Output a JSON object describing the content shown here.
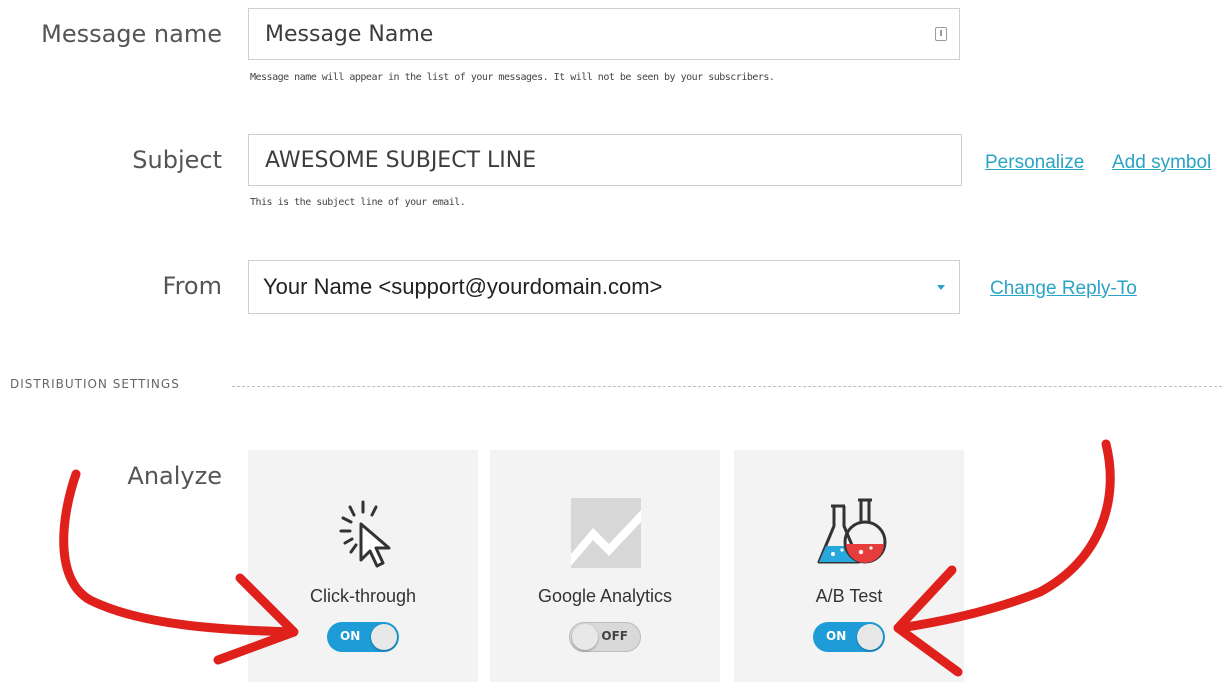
{
  "form": {
    "message_name": {
      "label": "Message name",
      "value": "Message Name",
      "help": "Message name will appear in the list of your messages. It will not be seen by your subscribers.",
      "icon": "character-count-icon"
    },
    "subject": {
      "label": "Subject",
      "value": "AWESOME SUBJECT LINE",
      "help": "This is the subject line of your email.",
      "links": [
        "Personalize",
        "Add symbol"
      ]
    },
    "from": {
      "label": "From",
      "value": "Your Name <support@yourdomain.com>",
      "link": "Change Reply-To",
      "icon": "chevron-down-icon"
    }
  },
  "distribution": {
    "title": "DISTRIBUTION SETTINGS",
    "analyze_label": "Analyze",
    "cards": [
      {
        "label": "Click-through",
        "icon": "cursor-click-icon",
        "toggle": "ON",
        "enabled": true
      },
      {
        "label": "Google Analytics",
        "icon": "analytics-chart-icon",
        "toggle": "OFF",
        "enabled": false
      },
      {
        "label": "A/B Test",
        "icon": "lab-flasks-icon",
        "toggle": "ON",
        "enabled": true
      }
    ]
  },
  "colors": {
    "accent": "#2aa3c6",
    "toggle_on": "#1e9cd7",
    "annotation": "#e0201b"
  }
}
